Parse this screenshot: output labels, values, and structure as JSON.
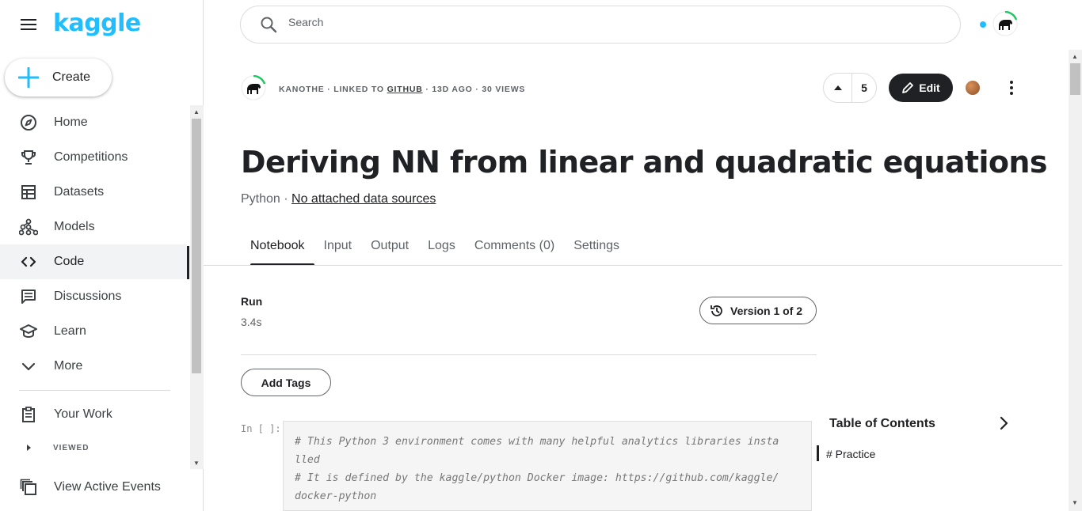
{
  "app": {
    "logo": "kaggle"
  },
  "sidebar": {
    "create_label": "Create",
    "items": [
      {
        "label": "Home",
        "icon": "compass-icon"
      },
      {
        "label": "Competitions",
        "icon": "trophy-icon"
      },
      {
        "label": "Datasets",
        "icon": "table-icon"
      },
      {
        "label": "Models",
        "icon": "models-icon"
      },
      {
        "label": "Code",
        "icon": "code-icon",
        "active": true
      },
      {
        "label": "Discussions",
        "icon": "comments-icon"
      },
      {
        "label": "Learn",
        "icon": "school-icon"
      },
      {
        "label": "More",
        "icon": "chevron-down-icon"
      },
      {
        "label": "Your Work",
        "icon": "clipboard-icon"
      },
      {
        "label": "VIEWED",
        "icon": "caret-right-icon"
      },
      {
        "label": "View Active Events",
        "icon": "library-icon"
      }
    ]
  },
  "search": {
    "placeholder": "Search"
  },
  "notebook": {
    "author": "KANOTHE",
    "meta_linked": "· LINKED TO ",
    "meta_github": "GITHUB",
    "meta_rest": " · 13D AGO · 30 VIEWS",
    "votes": "5",
    "edit_label": "Edit",
    "title": "Deriving NN from linear and quadratic equations",
    "language": "Python · ",
    "data_sources": "No attached data sources",
    "tabs": [
      "Notebook",
      "Input",
      "Output",
      "Logs",
      "Comments (0)",
      "Settings"
    ],
    "run_label": "Run",
    "run_value": "3.4s",
    "version_label": "Version 1 of 2",
    "add_tags_label": "Add Tags",
    "cell_prompt": "In [ ]:",
    "code_lines": [
      "# This Python 3 environment comes with many helpful analytics libraries insta",
      "lled",
      "# It is defined by the kaggle/python Docker image: https://github.com/kaggle/",
      "docker-python"
    ]
  },
  "toc": {
    "title": "Table of Contents",
    "items": [
      "# Practice"
    ]
  },
  "colors": {
    "brand": "#20beff",
    "primary_dark": "#202124"
  }
}
